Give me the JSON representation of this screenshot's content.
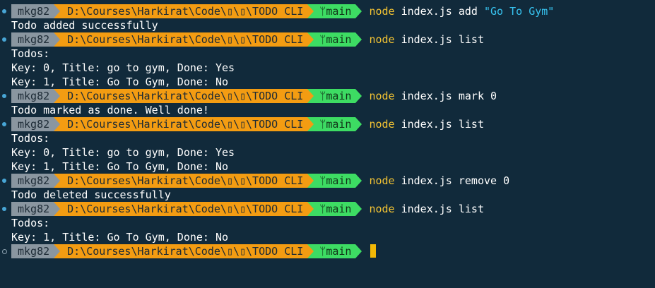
{
  "prompt": {
    "user": "mkg82",
    "path": "D:\\Courses\\Harkirat\\Code\\▯\\▯\\TODO CLI",
    "branch_icon": "git-branch-icon",
    "branch_glyph": "ᛘ",
    "branch": "main"
  },
  "colors": {
    "background": "#112a3b",
    "user_segment": "#8a96a0",
    "path_segment": "#f39c12",
    "git_segment": "#3ddc63",
    "command": "#f1c233",
    "string": "#37c3f0",
    "cursor": "#f2b807"
  },
  "lines": [
    {
      "type": "prompt",
      "cmd": "node",
      "args": "index.js add ",
      "str": "\"Go To Gym\""
    },
    {
      "type": "output",
      "text": "Todo added successfully"
    },
    {
      "type": "prompt",
      "cmd": "node",
      "args": "index.js list",
      "str": ""
    },
    {
      "type": "output",
      "text": "Todos:"
    },
    {
      "type": "output",
      "text": "Key: 0, Title: go to gym, Done: Yes"
    },
    {
      "type": "output",
      "text": "Key: 1, Title: Go To Gym, Done: No"
    },
    {
      "type": "prompt",
      "cmd": "node",
      "args": "index.js mark 0",
      "str": ""
    },
    {
      "type": "output",
      "text": "Todo marked as done. Well done!"
    },
    {
      "type": "prompt",
      "cmd": "node",
      "args": "index.js list",
      "str": ""
    },
    {
      "type": "output",
      "text": "Todos:"
    },
    {
      "type": "output",
      "text": "Key: 0, Title: go to gym, Done: Yes"
    },
    {
      "type": "output",
      "text": "Key: 1, Title: Go To Gym, Done: No"
    },
    {
      "type": "prompt",
      "cmd": "node",
      "args": "index.js remove 0",
      "str": ""
    },
    {
      "type": "output",
      "text": "Todo deleted successfully"
    },
    {
      "type": "prompt",
      "cmd": "node",
      "args": "index.js list",
      "str": ""
    },
    {
      "type": "output",
      "text": "Todos:"
    },
    {
      "type": "output",
      "text": "Key: 1, Title: Go To Gym, Done: No"
    },
    {
      "type": "prompt-active",
      "cmd": "",
      "args": "",
      "str": ""
    }
  ]
}
